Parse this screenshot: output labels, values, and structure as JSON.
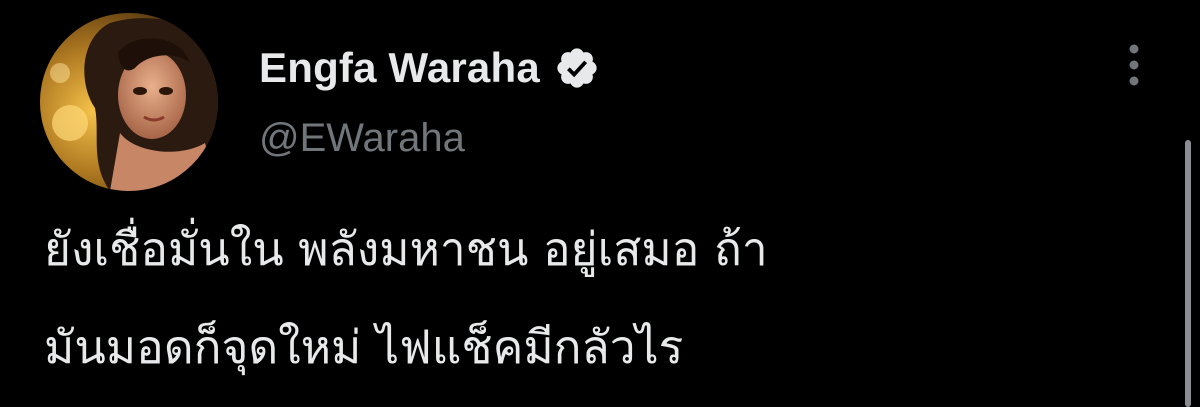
{
  "author": {
    "display_name": "Engfa Waraha",
    "handle": "@EWaraha",
    "verified": true,
    "avatar_icon": "profile-photo-avatar"
  },
  "tweet": {
    "lines": [
      "ยังเชื่อมั่นใน พลังมหาชน อยู่เสมอ ถ้า",
      "มันมอดก็จุดใหม่ ไฟแช็คมีกลัวไร"
    ]
  },
  "actions": {
    "more_icon": "more-options-icon"
  },
  "colors": {
    "background": "#000000",
    "name": "#e7e9ea",
    "handle": "#71767b",
    "verified_badge": "#e7e9ea",
    "text": "#e7e9ea"
  }
}
